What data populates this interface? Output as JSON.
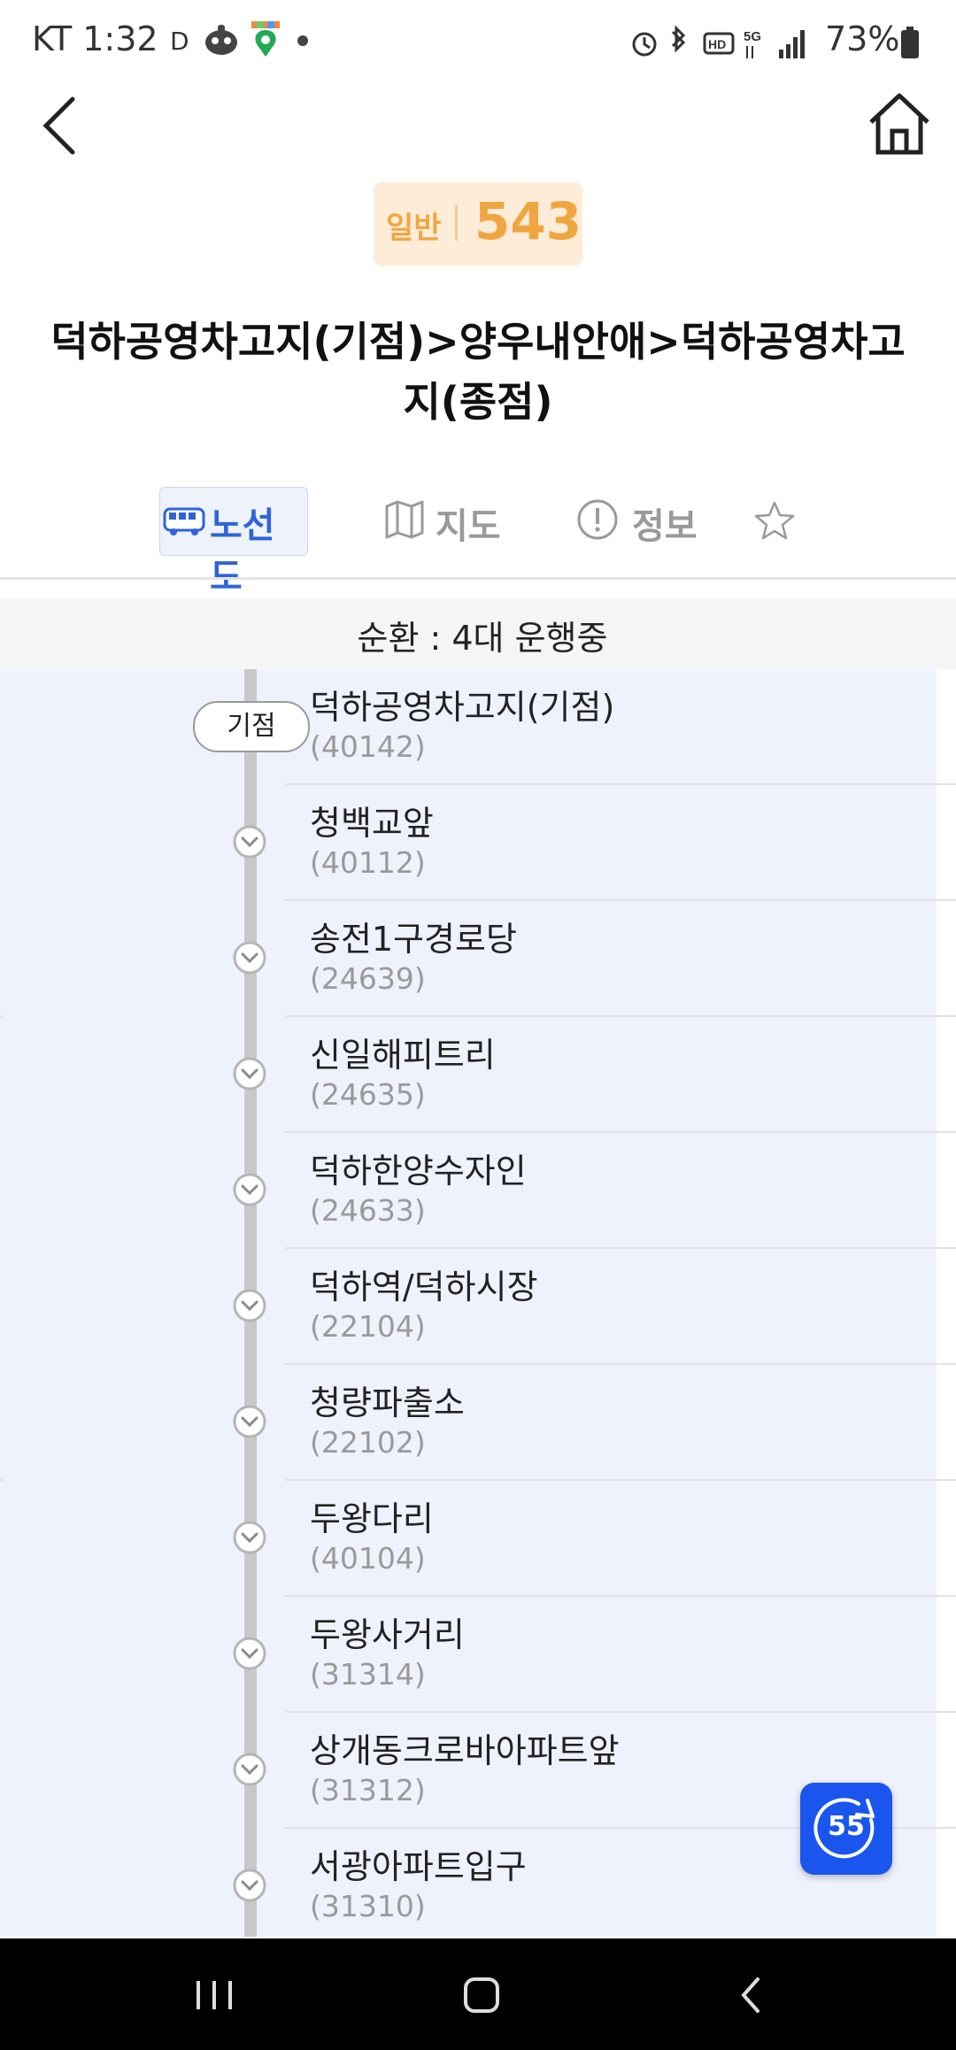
{
  "status_bar": {
    "time": "KT 1:32",
    "d_mark": "D",
    "battery": "73%"
  },
  "header": {
    "route_type": "일반",
    "route_number": "543",
    "title": "덕하공영차고지(기점)>양우내안애>덕하공영차고지(종점)"
  },
  "tabs": [
    {
      "label": "노선도",
      "icon": "bus-icon",
      "active": true
    },
    {
      "label": "지도",
      "icon": "map-icon",
      "active": false
    },
    {
      "label": "정보",
      "icon": "info-icon",
      "active": false
    },
    {
      "label": "",
      "icon": "star-icon",
      "active": false
    }
  ],
  "circulation": {
    "text": "순환 : 4대 운행중"
  },
  "origin_label": "기점",
  "stops": [
    {
      "name": "덕하공영차고지(기점)",
      "code": "(40142)"
    },
    {
      "name": "청백교앞",
      "code": "(40112)"
    },
    {
      "name": "송전1구경로당",
      "code": "(24639)"
    },
    {
      "name": "신일해피트리",
      "code": "(24635)"
    },
    {
      "name": "덕하한양수자인",
      "code": "(24633)"
    },
    {
      "name": "덕하역/덕하시장",
      "code": "(22104)"
    },
    {
      "name": "청량파출소",
      "code": "(22102)"
    },
    {
      "name": "두왕다리",
      "code": "(40104)"
    },
    {
      "name": "두왕사거리",
      "code": "(31314)"
    },
    {
      "name": "상개동크로바아파트앞",
      "code": "(31312)"
    },
    {
      "name": "서광아파트입구",
      "code": "(31310)"
    }
  ],
  "refresh": {
    "countdown": "55"
  },
  "colors": {
    "accent_blue": "#2f64d8",
    "badge_orange": "#f0a640",
    "list_background": "#eef2fc"
  }
}
